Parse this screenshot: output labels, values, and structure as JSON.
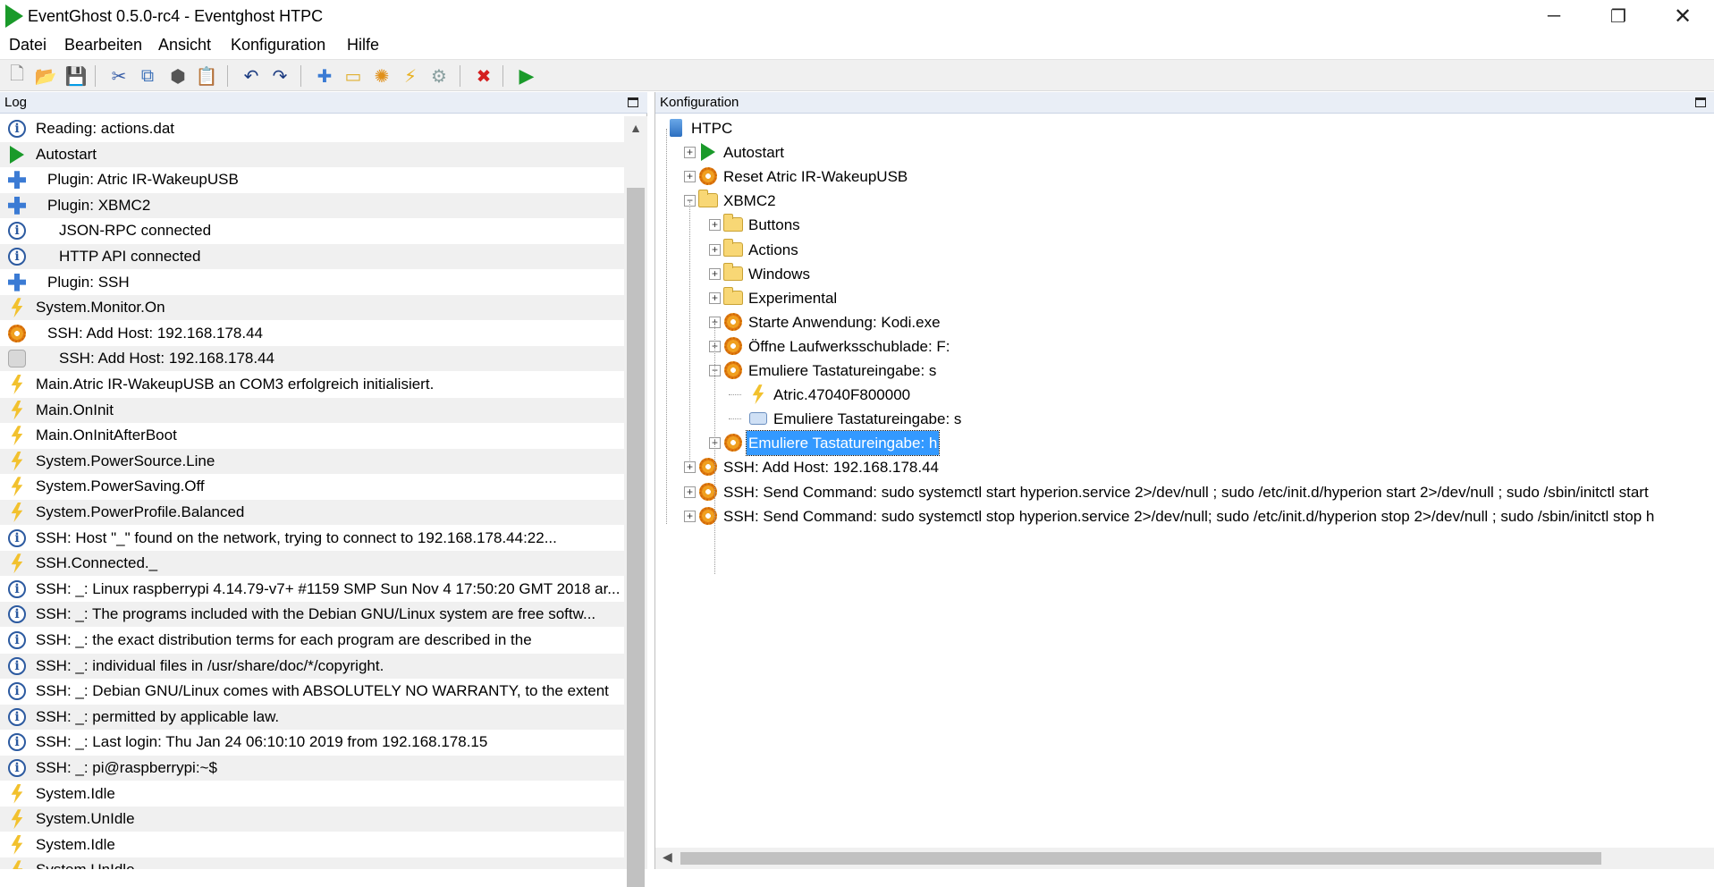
{
  "window": {
    "title": "EventGhost 0.5.0-rc4 - Eventghost HTPC",
    "minimize_glyph": "─",
    "maximize_glyph": "❐",
    "close_glyph": "✕"
  },
  "menu": [
    {
      "label": "Datei"
    },
    {
      "label": "Bearbeiten"
    },
    {
      "label": "Ansicht"
    },
    {
      "label": "Konfiguration"
    },
    {
      "label": "Hilfe"
    }
  ],
  "toolbar": [
    {
      "icon": "new-file-icon",
      "glyph": "🗋",
      "color": "#888888"
    },
    {
      "icon": "open-folder-icon",
      "glyph": "📂",
      "color": "#d9a520"
    },
    {
      "icon": "save-icon",
      "glyph": "💾",
      "color": "#2a5db0"
    },
    {
      "icon": "cut-icon",
      "glyph": "✂",
      "color": "#3a5fa8"
    },
    {
      "icon": "copy-icon",
      "glyph": "⧉",
      "color": "#3a6fb8"
    },
    {
      "icon": "python-icon",
      "glyph": "⬢",
      "color": "#555555"
    },
    {
      "icon": "paste-icon",
      "glyph": "📋",
      "color": "#666666"
    },
    {
      "icon": "undo-icon",
      "glyph": "↶",
      "color": "#1a3a80"
    },
    {
      "icon": "redo-icon",
      "glyph": "↷",
      "color": "#1a3a80"
    },
    {
      "icon": "add-plugin-icon",
      "glyph": "✚",
      "color": "#3b7bd4"
    },
    {
      "icon": "add-folder-icon",
      "glyph": "▭",
      "color": "#e0b030"
    },
    {
      "icon": "add-macro-icon",
      "glyph": "✺",
      "color": "#e0901a"
    },
    {
      "icon": "add-event-icon",
      "glyph": "⚡",
      "color": "#e8b020"
    },
    {
      "icon": "add-action-icon",
      "glyph": "⚙",
      "color": "#8aa0a0"
    },
    {
      "icon": "disable-icon",
      "glyph": "✖",
      "color": "#d42020"
    },
    {
      "icon": "execute-icon",
      "glyph": "▶",
      "color": "#1a9a2a"
    }
  ],
  "log": {
    "header": "Log",
    "entries": [
      {
        "icon": "info",
        "indent": 0,
        "text": "Reading: actions.dat"
      },
      {
        "icon": "play",
        "indent": 0,
        "text": "Autostart"
      },
      {
        "icon": "plugin",
        "indent": 1,
        "text": "Plugin: Atric IR-WakeupUSB"
      },
      {
        "icon": "plugin",
        "indent": 1,
        "text": "Plugin: XBMC2"
      },
      {
        "icon": "info",
        "indent": 2,
        "text": "JSON-RPC connected"
      },
      {
        "icon": "info",
        "indent": 2,
        "text": "HTTP API connected"
      },
      {
        "icon": "plugin",
        "indent": 1,
        "text": "Plugin: SSH"
      },
      {
        "icon": "bolt",
        "indent": 0,
        "text": "System.Monitor.On"
      },
      {
        "icon": "gear",
        "indent": 1,
        "text": "SSH: Add Host: 192.168.178.44"
      },
      {
        "icon": "gear-grey",
        "indent": 2,
        "text": "SSH: Add Host: 192.168.178.44"
      },
      {
        "icon": "bolt",
        "indent": 0,
        "text": "Main.Atric IR-WakeupUSB an COM3 erfolgreich initialisiert."
      },
      {
        "icon": "bolt",
        "indent": 0,
        "text": "Main.OnInit"
      },
      {
        "icon": "bolt",
        "indent": 0,
        "text": "Main.OnInitAfterBoot"
      },
      {
        "icon": "bolt",
        "indent": 0,
        "text": "System.PowerSource.Line"
      },
      {
        "icon": "bolt",
        "indent": 0,
        "text": "System.PowerSaving.Off"
      },
      {
        "icon": "bolt",
        "indent": 0,
        "text": "System.PowerProfile.Balanced"
      },
      {
        "icon": "info",
        "indent": 0,
        "text": "SSH: Host \"_\" found on the network, trying to connect to 192.168.178.44:22..."
      },
      {
        "icon": "bolt",
        "indent": 0,
        "text": "SSH.Connected._"
      },
      {
        "icon": "info",
        "indent": 0,
        "text": "SSH: _: Linux raspberrypi 4.14.79-v7+ #1159 SMP Sun Nov 4 17:50:20 GMT 2018 ar..."
      },
      {
        "icon": "info",
        "indent": 0,
        "text": "SSH: _: The programs included with the Debian GNU/Linux system are free softw..."
      },
      {
        "icon": "info",
        "indent": 0,
        "text": "SSH: _: the exact distribution terms for each program are described in the"
      },
      {
        "icon": "info",
        "indent": 0,
        "text": "SSH: _: individual files in /usr/share/doc/*/copyright."
      },
      {
        "icon": "info",
        "indent": 0,
        "text": "SSH: _: Debian GNU/Linux comes with ABSOLUTELY NO WARRANTY, to the extent"
      },
      {
        "icon": "info",
        "indent": 0,
        "text": "SSH: _: permitted by applicable law."
      },
      {
        "icon": "info",
        "indent": 0,
        "text": "SSH: _: Last login: Thu Jan 24 06:10:10 2019 from 192.168.178.15"
      },
      {
        "icon": "info",
        "indent": 0,
        "text": "SSH: _: pi@raspberrypi:~$"
      },
      {
        "icon": "bolt",
        "indent": 0,
        "text": "System.Idle"
      },
      {
        "icon": "bolt",
        "indent": 0,
        "text": "System.UnIdle"
      },
      {
        "icon": "bolt",
        "indent": 0,
        "text": "System.Idle"
      },
      {
        "icon": "bolt",
        "indent": 0,
        "text": "System.UnIdle"
      }
    ]
  },
  "config": {
    "header": "Konfiguration",
    "tree": [
      {
        "level": 0,
        "icon": "pc",
        "expander": "",
        "label": "HTPC"
      },
      {
        "level": 1,
        "icon": "play",
        "expander": "+",
        "label": "Autostart"
      },
      {
        "level": 1,
        "icon": "gear",
        "expander": "+",
        "label": "Reset Atric IR-WakeupUSB"
      },
      {
        "level": 1,
        "icon": "folder",
        "expander": "−",
        "label": "XBMC2"
      },
      {
        "level": 2,
        "icon": "folder",
        "expander": "+",
        "label": "Buttons"
      },
      {
        "level": 2,
        "icon": "folder",
        "expander": "+",
        "label": "Actions"
      },
      {
        "level": 2,
        "icon": "folder",
        "expander": "+",
        "label": "Windows"
      },
      {
        "level": 2,
        "icon": "folder",
        "expander": "+",
        "label": "Experimental"
      },
      {
        "level": 2,
        "icon": "gear",
        "expander": "+",
        "label": "Starte Anwendung: Kodi.exe"
      },
      {
        "level": 2,
        "icon": "gear",
        "expander": "+",
        "label": "Öffne Laufwerksschublade: F:"
      },
      {
        "level": 2,
        "icon": "gear",
        "expander": "−",
        "label": "Emuliere Tastatureingabe: s"
      },
      {
        "level": 3,
        "icon": "bolt",
        "expander": "",
        "label": "Atric.47040F800000"
      },
      {
        "level": 3,
        "icon": "kbd",
        "expander": "",
        "label": "Emuliere Tastatureingabe: s"
      },
      {
        "level": 2,
        "icon": "gear",
        "expander": "+",
        "label": "Emuliere Tastatureingabe: h",
        "selected": true
      },
      {
        "level": 1,
        "icon": "gear",
        "expander": "+",
        "label": "SSH: Add Host: 192.168.178.44"
      },
      {
        "level": 1,
        "icon": "gear",
        "expander": "+",
        "label": "SSH: Send Command: sudo systemctl start hyperion.service 2>/dev/null ; sudo /etc/init.d/hyperion start 2>/dev/null ; sudo /sbin/initctl start"
      },
      {
        "level": 1,
        "icon": "gear",
        "expander": "+",
        "label": "SSH: Send Command: sudo systemctl stop hyperion.service 2>/dev/null; sudo /etc/init.d/hyperion stop 2>/dev/null ; sudo /sbin/initctl stop h"
      }
    ]
  },
  "scrollbars": {
    "log_up_arrow": "▲",
    "cfg_left_arrow": "◀"
  }
}
